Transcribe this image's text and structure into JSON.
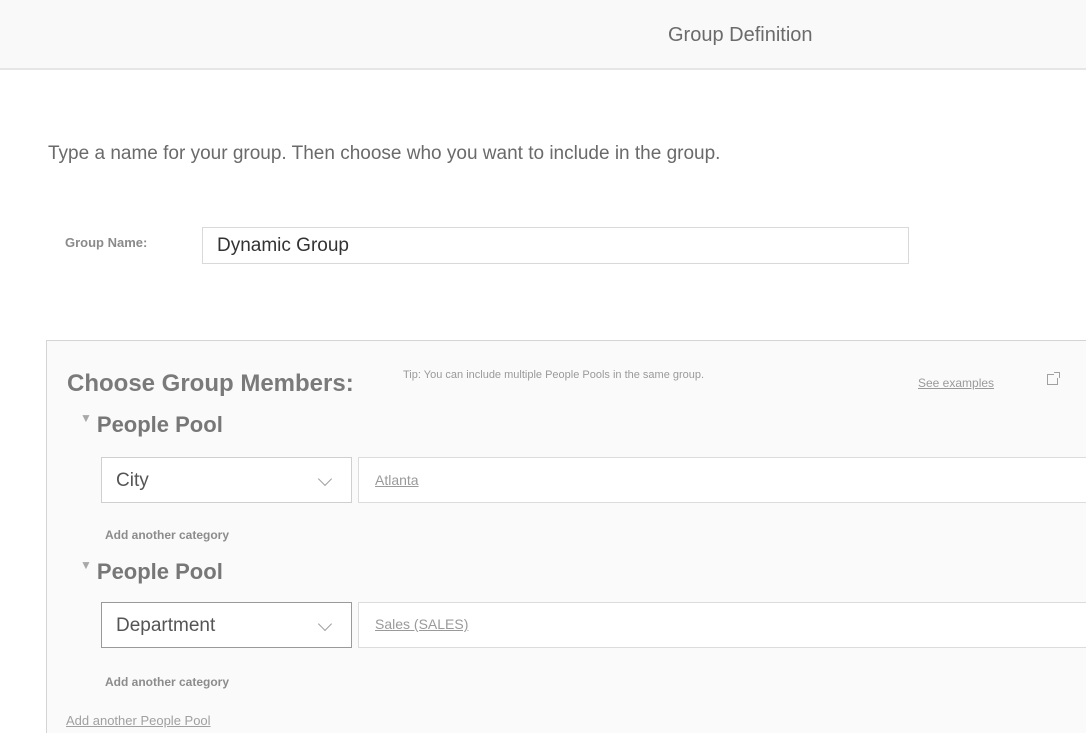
{
  "header": {
    "title": "Group Definition"
  },
  "intro_text": "Type a name for your group. Then choose who you want to include in the group.",
  "group_name": {
    "label": "Group Name:",
    "value": "Dynamic Group"
  },
  "members": {
    "title": "Choose Group Members:",
    "tip": "Tip: You can include multiple People Pools in the same group.",
    "see_examples": "See examples",
    "pools": [
      {
        "title": "People Pool",
        "category": "City",
        "value": "Atlanta",
        "add_category": "Add another category"
      },
      {
        "title": "People Pool",
        "category": "Department",
        "value": "Sales (SALES)",
        "add_category": "Add another category"
      }
    ],
    "add_pool": "Add another People Pool"
  },
  "icons": {
    "caret": "caret-down-icon",
    "chevron": "chevron-down-icon",
    "external": "external-link-icon"
  },
  "colors": {
    "header_bg": "#f9f9f9",
    "panel_bg": "#fafafa",
    "border": "#d4d4d4"
  }
}
